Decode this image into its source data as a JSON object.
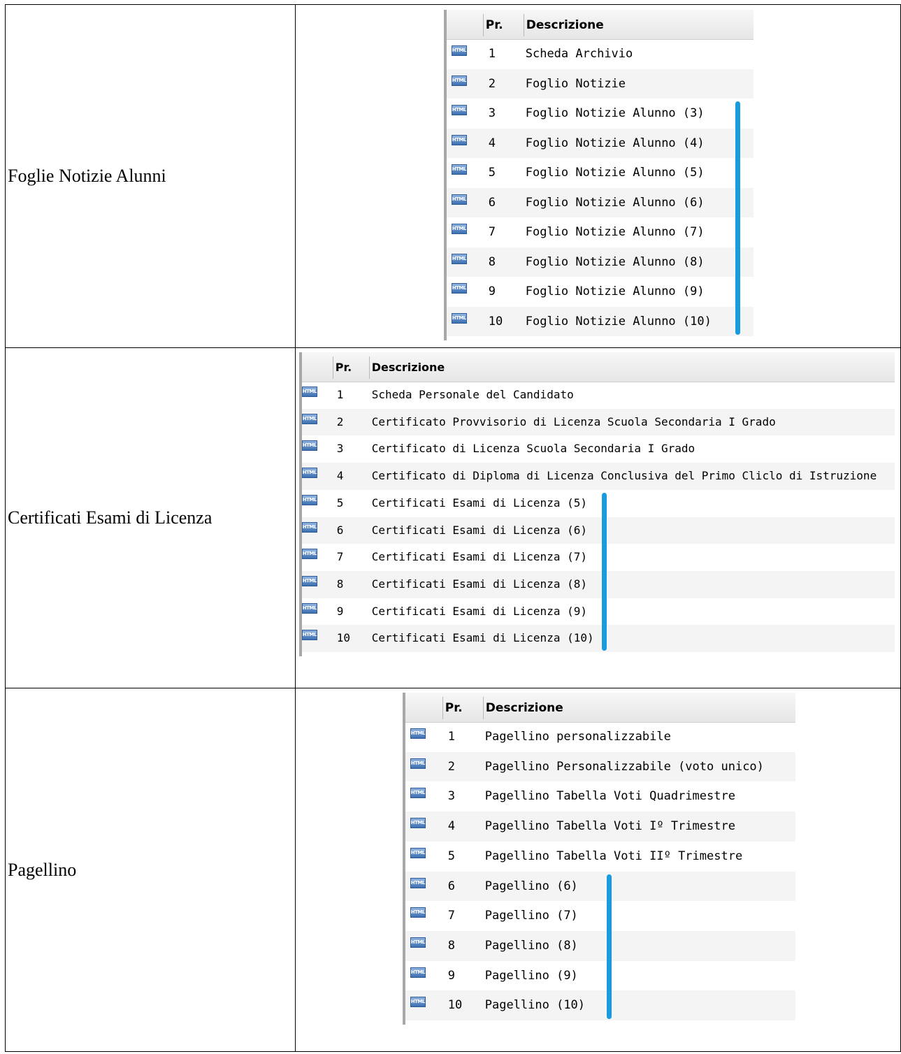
{
  "sections": [
    {
      "label": "Foglie Notizie Alunni",
      "header": {
        "pr": "Pr.",
        "descrizione": "Descrizione"
      },
      "icon_label": "HTML",
      "rows": [
        {
          "n": "1",
          "d": "Scheda Archivio"
        },
        {
          "n": "2",
          "d": "Foglio Notizie"
        },
        {
          "n": "3",
          "d": "Foglio Notizie Alunno (3)"
        },
        {
          "n": "4",
          "d": "Foglio Notizie Alunno (4)"
        },
        {
          "n": "5",
          "d": "Foglio Notizie Alunno (5)"
        },
        {
          "n": "6",
          "d": "Foglio Notizie Alunno (6)"
        },
        {
          "n": "7",
          "d": "Foglio Notizie Alunno (7)"
        },
        {
          "n": "8",
          "d": "Foglio Notizie Alunno (8)"
        },
        {
          "n": "9",
          "d": "Foglio Notizie Alunno (9)"
        },
        {
          "n": "10",
          "d": "Foglio Notizie Alunno (10)"
        }
      ]
    },
    {
      "label": "Certificati Esami di Licenza",
      "header": {
        "pr": "Pr.",
        "descrizione": "Descrizione"
      },
      "icon_label": "HTML",
      "rows": [
        {
          "n": "1",
          "d": "Scheda Personale del Candidato"
        },
        {
          "n": "2",
          "d": "Certificato Provvisorio di Licenza Scuola Secondaria I Grado"
        },
        {
          "n": "3",
          "d": "Certificato di Licenza Scuola Secondaria I Grado"
        },
        {
          "n": "4",
          "d": "Certificato di Diploma di Licenza Conclusiva del Primo Cliclo di Istruzione"
        },
        {
          "n": "5",
          "d": "Certificati Esami di Licenza (5)"
        },
        {
          "n": "6",
          "d": "Certificati Esami di Licenza (6)"
        },
        {
          "n": "7",
          "d": "Certificati Esami di Licenza (7)"
        },
        {
          "n": "8",
          "d": "Certificati Esami di Licenza (8)"
        },
        {
          "n": "9",
          "d": "Certificati Esami di Licenza (9)"
        },
        {
          "n": "10",
          "d": "Certificati Esami di Licenza (10)"
        }
      ]
    },
    {
      "label": "Pagellino",
      "header": {
        "pr": "Pr.",
        "descrizione": "Descrizione"
      },
      "icon_label": "HTML",
      "rows": [
        {
          "n": "1",
          "d": "Pagellino personalizzabile"
        },
        {
          "n": "2",
          "d": "Pagellino Personalizzabile (voto unico)"
        },
        {
          "n": "3",
          "d": "Pagellino Tabella Voti Quadrimestre"
        },
        {
          "n": "4",
          "d": "Pagellino Tabella Voti Iº Trimestre"
        },
        {
          "n": "5",
          "d": "Pagellino Tabella Voti IIº Trimestre"
        },
        {
          "n": "6",
          "d": "Pagellino (6)"
        },
        {
          "n": "7",
          "d": "Pagellino (7)"
        },
        {
          "n": "8",
          "d": "Pagellino (8)"
        },
        {
          "n": "9",
          "d": "Pagellino (9)"
        },
        {
          "n": "10",
          "d": "Pagellino (10)"
        }
      ]
    }
  ],
  "colors": {
    "highlight_bar": "#1a9be0",
    "alt_row": "#f4f4f4"
  }
}
